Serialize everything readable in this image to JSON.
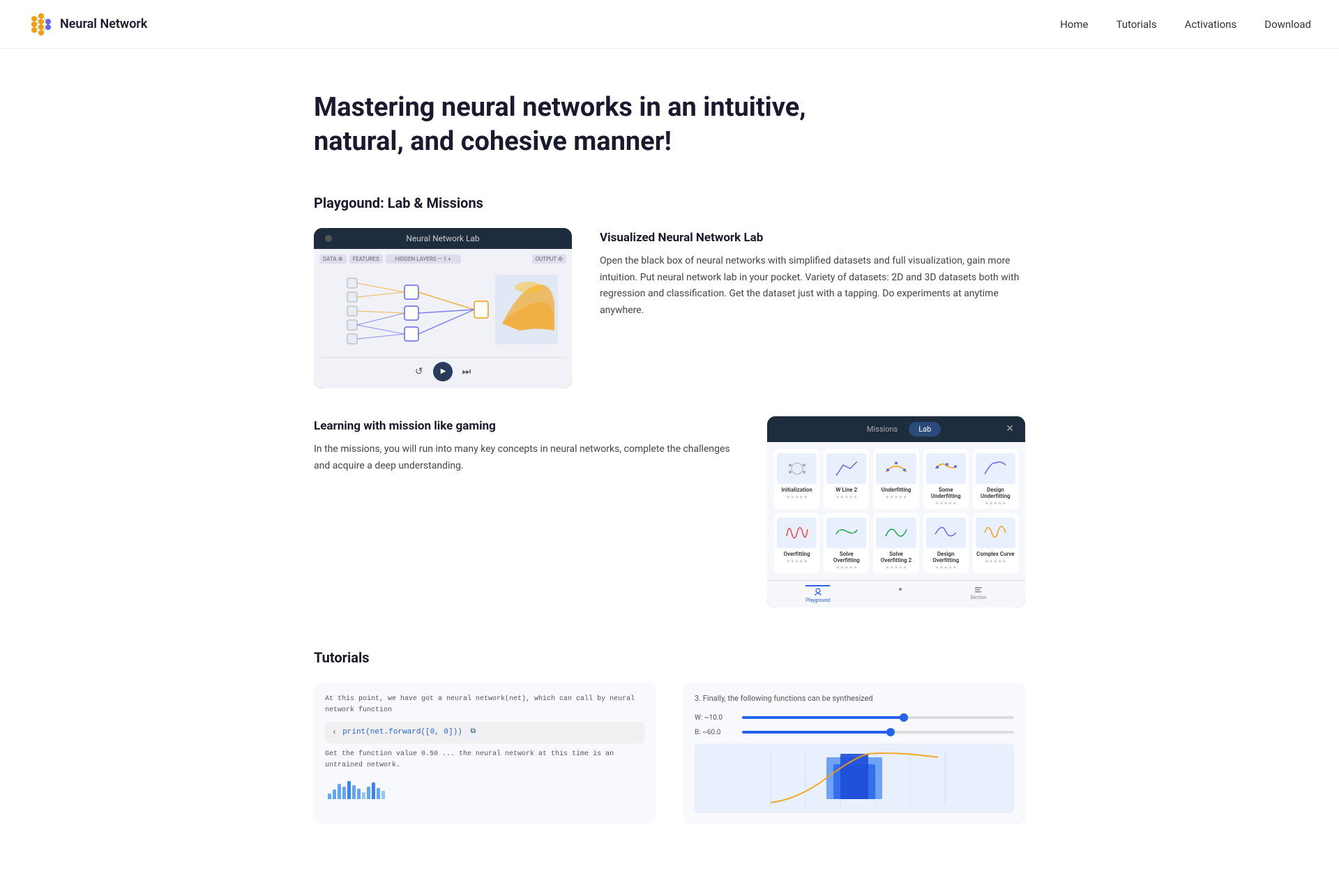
{
  "nav": {
    "title": "Neural Network",
    "links": [
      {
        "label": "Home",
        "id": "home"
      },
      {
        "label": "Tutorials",
        "id": "tutorials"
      },
      {
        "label": "Activations",
        "id": "activations"
      },
      {
        "label": "Download",
        "id": "download"
      }
    ]
  },
  "hero": {
    "title": "Mastering neural networks in an intuitive, natural, and cohesive manner!"
  },
  "playground": {
    "section_title": "Playgound: Lab & Missions",
    "lab": {
      "title": "Visualized Neural Network Lab",
      "description": "Open the black box of neural networks with simplified datasets and full visualization, gain more intuition.\nPut neural network lab in your pocket. Variety of datasets: 2D and 3D datasets both with regression and classification. Get the dataset just with a tapping. Do experiments at anytime anywhere.",
      "topbar_title": "Neural Network Lab",
      "col_labels": [
        "DATA ⚙",
        "FEATURES",
        "HIDDEN LAYERS — 1 +",
        "OUTPUT ⚙"
      ]
    },
    "missions": {
      "learning_title": "Learning with mission like gaming",
      "learning_desc": "In the missions, you will run into many key concepts in neural networks, complete the challenges and acquire a deep understanding.",
      "topbar_tabs": [
        "Missions",
        "Lab"
      ],
      "cards_row1": [
        {
          "label": "Initialization",
          "stars": "★★★★★"
        },
        {
          "label": "W Line 2",
          "stars": "★★★★★"
        },
        {
          "label": "Underfitting",
          "stars": "★★★★★"
        },
        {
          "label": "Some Underfitting",
          "stars": "★★★★★"
        },
        {
          "label": "Design Underfitting",
          "stars": "★★★★★"
        }
      ],
      "cards_row2": [
        {
          "label": "Overfitting",
          "stars": "★★★★★"
        },
        {
          "label": "Solve Overfitting",
          "stars": "★★★★★"
        },
        {
          "label": "Solve Overfitting 2",
          "stars": "★★★★★"
        },
        {
          "label": "Design Overfitting",
          "stars": "★★★★★"
        },
        {
          "label": "Complex Curve",
          "stars": "★★★★★"
        }
      ],
      "bottom_tabs": [
        "Playground",
        "·",
        "Section"
      ]
    }
  },
  "tutorials": {
    "section_title": "Tutorials",
    "code_snippet": {
      "comment": "At this point, we have got a neural network(net), which can call by neural network function",
      "line1": "print(net.forward([0, 0]))",
      "desc": "Get the function value 0.50 ... the neural network at this time is an untrained network."
    },
    "chart": {
      "title": "3. Finally, the following functions can be synthesized",
      "slider1_label": "W: ~10.0",
      "slider1_value": 60,
      "slider2_label": "B: ~60.0",
      "slider2_value": 55
    }
  },
  "colors": {
    "nav_bg": "#ffffff",
    "accent": "#2563eb",
    "dark": "#1a1a2e",
    "lab_dark": "#1e2d3d",
    "text_muted": "#666666"
  }
}
